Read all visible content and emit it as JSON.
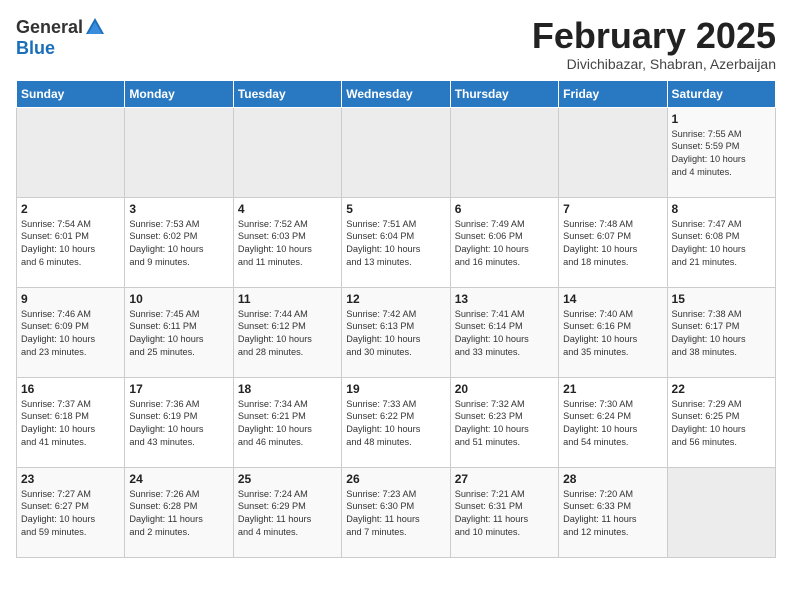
{
  "header": {
    "logo_general": "General",
    "logo_blue": "Blue",
    "month_title": "February 2025",
    "location": "Divichibazar, Shabran, Azerbaijan"
  },
  "weekdays": [
    "Sunday",
    "Monday",
    "Tuesday",
    "Wednesday",
    "Thursday",
    "Friday",
    "Saturday"
  ],
  "weeks": [
    [
      {
        "day": "",
        "info": ""
      },
      {
        "day": "",
        "info": ""
      },
      {
        "day": "",
        "info": ""
      },
      {
        "day": "",
        "info": ""
      },
      {
        "day": "",
        "info": ""
      },
      {
        "day": "",
        "info": ""
      },
      {
        "day": "1",
        "info": "Sunrise: 7:55 AM\nSunset: 5:59 PM\nDaylight: 10 hours\nand 4 minutes."
      }
    ],
    [
      {
        "day": "2",
        "info": "Sunrise: 7:54 AM\nSunset: 6:01 PM\nDaylight: 10 hours\nand 6 minutes."
      },
      {
        "day": "3",
        "info": "Sunrise: 7:53 AM\nSunset: 6:02 PM\nDaylight: 10 hours\nand 9 minutes."
      },
      {
        "day": "4",
        "info": "Sunrise: 7:52 AM\nSunset: 6:03 PM\nDaylight: 10 hours\nand 11 minutes."
      },
      {
        "day": "5",
        "info": "Sunrise: 7:51 AM\nSunset: 6:04 PM\nDaylight: 10 hours\nand 13 minutes."
      },
      {
        "day": "6",
        "info": "Sunrise: 7:49 AM\nSunset: 6:06 PM\nDaylight: 10 hours\nand 16 minutes."
      },
      {
        "day": "7",
        "info": "Sunrise: 7:48 AM\nSunset: 6:07 PM\nDaylight: 10 hours\nand 18 minutes."
      },
      {
        "day": "8",
        "info": "Sunrise: 7:47 AM\nSunset: 6:08 PM\nDaylight: 10 hours\nand 21 minutes."
      }
    ],
    [
      {
        "day": "9",
        "info": "Sunrise: 7:46 AM\nSunset: 6:09 PM\nDaylight: 10 hours\nand 23 minutes."
      },
      {
        "day": "10",
        "info": "Sunrise: 7:45 AM\nSunset: 6:11 PM\nDaylight: 10 hours\nand 25 minutes."
      },
      {
        "day": "11",
        "info": "Sunrise: 7:44 AM\nSunset: 6:12 PM\nDaylight: 10 hours\nand 28 minutes."
      },
      {
        "day": "12",
        "info": "Sunrise: 7:42 AM\nSunset: 6:13 PM\nDaylight: 10 hours\nand 30 minutes."
      },
      {
        "day": "13",
        "info": "Sunrise: 7:41 AM\nSunset: 6:14 PM\nDaylight: 10 hours\nand 33 minutes."
      },
      {
        "day": "14",
        "info": "Sunrise: 7:40 AM\nSunset: 6:16 PM\nDaylight: 10 hours\nand 35 minutes."
      },
      {
        "day": "15",
        "info": "Sunrise: 7:38 AM\nSunset: 6:17 PM\nDaylight: 10 hours\nand 38 minutes."
      }
    ],
    [
      {
        "day": "16",
        "info": "Sunrise: 7:37 AM\nSunset: 6:18 PM\nDaylight: 10 hours\nand 41 minutes."
      },
      {
        "day": "17",
        "info": "Sunrise: 7:36 AM\nSunset: 6:19 PM\nDaylight: 10 hours\nand 43 minutes."
      },
      {
        "day": "18",
        "info": "Sunrise: 7:34 AM\nSunset: 6:21 PM\nDaylight: 10 hours\nand 46 minutes."
      },
      {
        "day": "19",
        "info": "Sunrise: 7:33 AM\nSunset: 6:22 PM\nDaylight: 10 hours\nand 48 minutes."
      },
      {
        "day": "20",
        "info": "Sunrise: 7:32 AM\nSunset: 6:23 PM\nDaylight: 10 hours\nand 51 minutes."
      },
      {
        "day": "21",
        "info": "Sunrise: 7:30 AM\nSunset: 6:24 PM\nDaylight: 10 hours\nand 54 minutes."
      },
      {
        "day": "22",
        "info": "Sunrise: 7:29 AM\nSunset: 6:25 PM\nDaylight: 10 hours\nand 56 minutes."
      }
    ],
    [
      {
        "day": "23",
        "info": "Sunrise: 7:27 AM\nSunset: 6:27 PM\nDaylight: 10 hours\nand 59 minutes."
      },
      {
        "day": "24",
        "info": "Sunrise: 7:26 AM\nSunset: 6:28 PM\nDaylight: 11 hours\nand 2 minutes."
      },
      {
        "day": "25",
        "info": "Sunrise: 7:24 AM\nSunset: 6:29 PM\nDaylight: 11 hours\nand 4 minutes."
      },
      {
        "day": "26",
        "info": "Sunrise: 7:23 AM\nSunset: 6:30 PM\nDaylight: 11 hours\nand 7 minutes."
      },
      {
        "day": "27",
        "info": "Sunrise: 7:21 AM\nSunset: 6:31 PM\nDaylight: 11 hours\nand 10 minutes."
      },
      {
        "day": "28",
        "info": "Sunrise: 7:20 AM\nSunset: 6:33 PM\nDaylight: 11 hours\nand 12 minutes."
      },
      {
        "day": "",
        "info": ""
      }
    ]
  ]
}
